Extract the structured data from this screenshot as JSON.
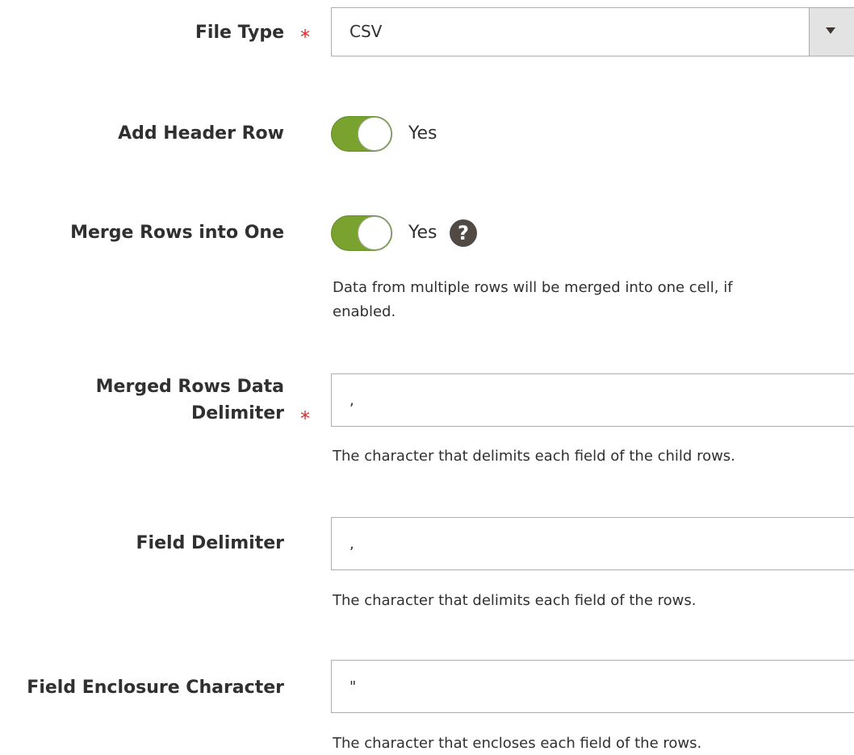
{
  "file_type": {
    "label": "File Type",
    "required": "*",
    "value": "CSV"
  },
  "add_header_row": {
    "label": "Add Header Row",
    "value": "Yes",
    "enabled": true
  },
  "merge_rows": {
    "label": "Merge Rows into One",
    "value": "Yes",
    "enabled": true,
    "help": "?",
    "note_line1": "Data from multiple rows will be merged into one cell, if",
    "note_line2": "enabled."
  },
  "merged_rows_delimiter": {
    "label_line1": "Merged Rows Data",
    "label_line2": "Delimiter",
    "required": "*",
    "value": ",",
    "note": "The character that delimits each field of the child rows."
  },
  "field_delimiter": {
    "label": "Field Delimiter",
    "value": ",",
    "note": "The character that delimits each field of the rows."
  },
  "field_enclosure": {
    "label": "Field Enclosure Character",
    "value": "\"",
    "note": "The character that encloses each field of the rows."
  },
  "colors": {
    "toggle_on": "#79a22e",
    "required_star": "#e22626",
    "help_icon": "#514943"
  }
}
